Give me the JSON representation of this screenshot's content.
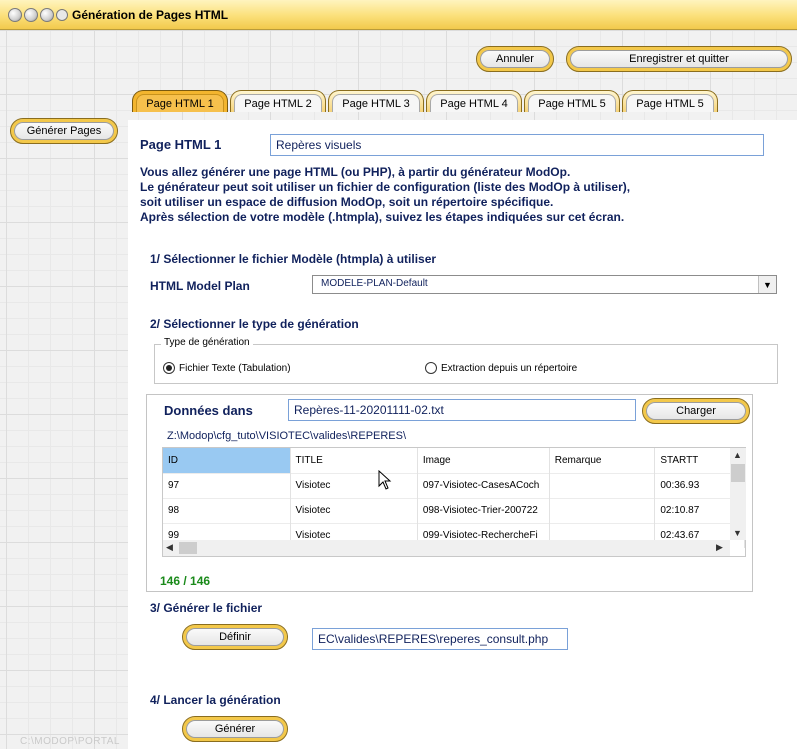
{
  "window": {
    "title": "Génération de Pages HTML"
  },
  "toolbar": {
    "cancel_label": "Annuler",
    "save_quit_label": "Enregistrer et quitter"
  },
  "tabs": [
    {
      "label": "Page HTML 1"
    },
    {
      "label": "Page HTML 2"
    },
    {
      "label": "Page HTML 3"
    },
    {
      "label": "Page HTML 4"
    },
    {
      "label": "Page HTML 5"
    },
    {
      "label": "Page HTML 5"
    }
  ],
  "left": {
    "generate_pages_label": "Générer Pages",
    "path_watermark": "C:\\MODOP\\PORTAL"
  },
  "page": {
    "title_label": "Page HTML 1",
    "title_value": "Repères visuels",
    "description": [
      "Vous allez générer une page HTML (ou PHP), à partir du générateur ModOp.",
      "Le générateur peut soit utiliser un fichier de configuration (liste des ModOp à utiliser),",
      "soit utiliser un espace de diffusion ModOp, soit un répertoire spécifique.",
      "Après sélection de votre modèle (.htmpla), suivez les étapes indiquées sur cet écran."
    ]
  },
  "step1": {
    "heading": "1/ Sélectionner le fichier Modèle (htmpla) à utiliser",
    "label": "HTML Model Plan",
    "value": "MODELE-PLAN-Default"
  },
  "step2": {
    "heading": "2/ Sélectionner le type de génération",
    "group_legend": "Type de génération",
    "option_text": "Fichier Texte (Tabulation)",
    "option_dir": "Extraction depuis un répertoire",
    "data_label": "Données dans",
    "data_file": "Repères-11-20201111-02.txt",
    "load_label": "Charger",
    "path": "Z:\\Modop\\cfg_tuto\\VISIOTEC\\valides\\REPERES\\",
    "columns": [
      "ID",
      "TITLE",
      "Image",
      "Remarque",
      "STARTT"
    ],
    "rows": [
      [
        "97",
        "Visiotec",
        "097-Visiotec-CasesACoch",
        "",
        "00:36.93"
      ],
      [
        "98",
        "Visiotec",
        "098-Visiotec-Trier-200722",
        "",
        "02:10.87"
      ],
      [
        "99",
        "Visiotec",
        "099-Visiotec-RechercheFi",
        "",
        "02:43.67"
      ]
    ],
    "count": "146 / 146"
  },
  "step3": {
    "heading": "3/ Générer le fichier",
    "define_label": "Définir",
    "output_value": "EC\\valides\\REPERES\\reperes_consult.php"
  },
  "step4": {
    "heading": "4/ Lancer la génération",
    "generate_label": "Générer"
  },
  "colors": {
    "accent": "#f3b52e",
    "navy": "#10215c",
    "count_green": "#1a8a1a"
  }
}
